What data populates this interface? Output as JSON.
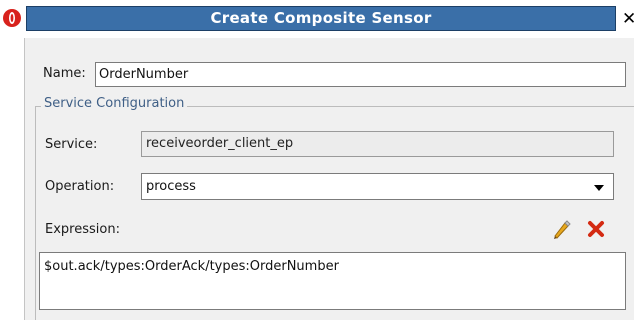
{
  "dialog": {
    "title": "Create Composite Sensor"
  },
  "name_field": {
    "label": "Name:",
    "value": "OrderNumber"
  },
  "service_configuration": {
    "legend": "Service Configuration",
    "service": {
      "label": "Service:",
      "value": "receiveorder_client_ep"
    },
    "operation": {
      "label": "Operation:",
      "selected": "process"
    },
    "expression": {
      "label": "Expression:",
      "value": "$out.ack/types:OrderAck/types:OrderNumber"
    }
  },
  "icons": {
    "app": "oracle-logo-icon",
    "close": "close-icon",
    "edit": "pencil-icon",
    "delete": "red-x-icon"
  },
  "colors": {
    "title_bar": "#3a6fa8",
    "legend_text": "#3f5f86",
    "delete_icon": "#d42a12",
    "edit_icon": "#e0a21a"
  }
}
